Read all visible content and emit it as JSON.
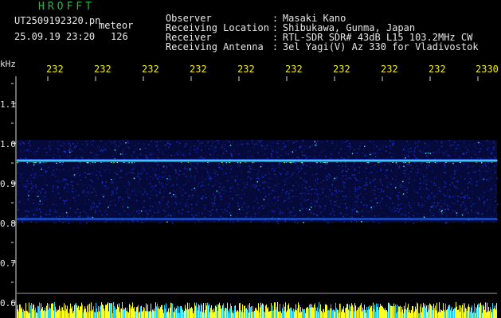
{
  "header": {
    "app_title": "HROFFT",
    "filename": "UT2509192320.pn",
    "tag": "meteor",
    "datetime": "25.09.19 23:20",
    "count": "126",
    "info": [
      {
        "label": "Observer",
        "value": "Masaki Kano"
      },
      {
        "label": "Receiving Location",
        "value": "Shibukawa, Gunma, Japan"
      },
      {
        "label": "Receiver",
        "value": "RTL-SDR SDR# 43dB L15 103.2MHz CW"
      },
      {
        "label": "Receiving Antenna",
        "value": "3el Yagi(V) Az 330 for Vladivostok"
      }
    ]
  },
  "axis": {
    "unit": "kHz",
    "time_labels": [
      "232",
      "232",
      "232",
      "232",
      "232",
      "232",
      "232",
      "232",
      "232",
      "2330"
    ],
    "freq_labels": [
      "1.1",
      "1.0",
      "0.9",
      "0.8",
      "0.7",
      "0.6"
    ]
  },
  "colors": {
    "background": "#000000",
    "title_green": "#1fbf3c",
    "time_yellow": "#f4f000",
    "text": "#e8e8e8",
    "noise_blue": "#1830c8",
    "signal_cyan": "#40e8ff",
    "signal_green": "#8cff60",
    "bottom_yellow": "#ffff20",
    "bottom_cyan": "#20d0ff"
  }
}
